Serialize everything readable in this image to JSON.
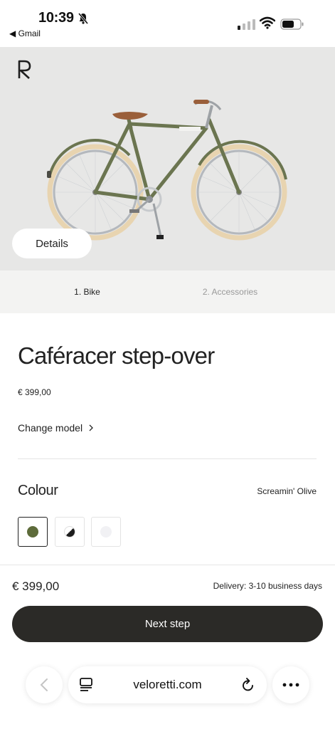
{
  "status_bar": {
    "time": "10:39",
    "back_app": "◀ Gmail"
  },
  "hero": {
    "details_label": "Details"
  },
  "steps": [
    {
      "label": "1. Bike",
      "active": true
    },
    {
      "label": "2. Accessories",
      "active": false
    }
  ],
  "product": {
    "title": "Caféracer step-over",
    "price": "€ 399,00",
    "change_model": "Change model"
  },
  "colour": {
    "label": "Colour",
    "selected_name": "Screamin' Olive",
    "swatches": [
      {
        "name": "olive",
        "color": "#5d6b3a",
        "selected": true
      },
      {
        "name": "black-white",
        "color": "#1e1e1e",
        "selected": false
      },
      {
        "name": "white",
        "color": "#f1f1f4",
        "selected": false
      }
    ]
  },
  "footer": {
    "price": "€ 399,00",
    "delivery": "Delivery: 3-10 business days",
    "next_step": "Next step"
  },
  "browser": {
    "url": "veloretti.com"
  },
  "colors": {
    "hero_bg": "#e7e7e6",
    "frame_olive": "#6b7550",
    "button_dark": "#2b2a27",
    "tyre_cream": "#e8d4b0"
  }
}
